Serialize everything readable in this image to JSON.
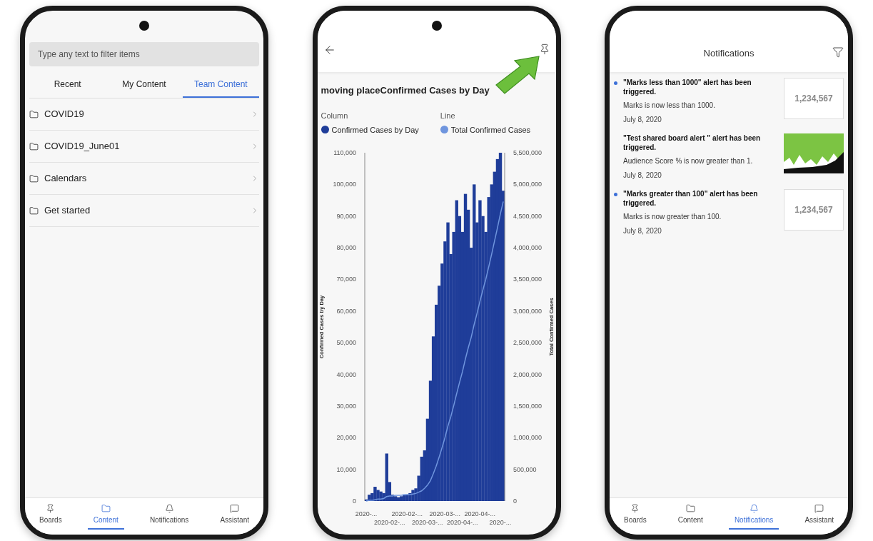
{
  "phones": [
    {
      "kind": "content",
      "search": {
        "placeholder": "Type any text to filter items"
      },
      "tabs": [
        {
          "label": "Recent",
          "selected": false
        },
        {
          "label": "My Content",
          "selected": false
        },
        {
          "label": "Team Content",
          "selected": true
        }
      ],
      "folders": [
        {
          "label": "COVID19"
        },
        {
          "label": "COVID19_June01"
        },
        {
          "label": "Calendars"
        },
        {
          "label": "Get started"
        }
      ],
      "nav": [
        {
          "kind": "boards",
          "label": "Boards",
          "selected": false
        },
        {
          "kind": "content",
          "label": "Content",
          "selected": true
        },
        {
          "kind": "notifications",
          "label": "Notifications",
          "selected": false
        },
        {
          "kind": "assistant",
          "label": "Assistant",
          "selected": false
        }
      ]
    },
    {
      "kind": "chart",
      "title": "moving placeConfirmed Cases by Day",
      "column_chart": {
        "legend_heading": "Column",
        "chart_data": {
          "type": "bar",
          "ylabel": "Confirmed Cases by Day",
          "series": [
            {
              "name": "Confirmed Cases by Day",
              "color": "#1f3d99",
              "values": [
                500,
                2000,
                2500,
                4500,
                3500,
                3000,
                2500,
                15000,
                6000,
                2000,
                1500,
                1200,
                1500,
                1800,
                2000,
                2500,
                3500,
                4000,
                8000,
                14000,
                16000,
                26000,
                38000,
                52000,
                62000,
                68000,
                75000,
                82000,
                88000,
                78000,
                85000,
                95000,
                90000,
                85000,
                97000,
                92000,
                80000,
                100000,
                88000,
                95000,
                90000,
                85000,
                96000,
                100000,
                104000,
                108000,
                110000,
                98000
              ]
            }
          ],
          "ylim": [
            0,
            110000
          ],
          "yticks": [
            {
              "value": 0,
              "label": "0"
            },
            {
              "value": 10000,
              "label": "10,000"
            },
            {
              "value": 20000,
              "label": "20,000"
            },
            {
              "value": 30000,
              "label": "30,000"
            },
            {
              "value": 40000,
              "label": "40,000"
            },
            {
              "value": 50000,
              "label": "50,000"
            },
            {
              "value": 60000,
              "label": "60,000"
            },
            {
              "value": 70000,
              "label": "70,000"
            },
            {
              "value": 80000,
              "label": "80,000"
            },
            {
              "value": 90000,
              "label": "90,000"
            },
            {
              "value": 100000,
              "label": "100,000"
            },
            {
              "value": 110000,
              "label": "110,000"
            }
          ],
          "categories": [
            "2020-...",
            null,
            null,
            null,
            null,
            null,
            null,
            null,
            "2020-02-...",
            null,
            null,
            null,
            null,
            null,
            "2020-02-...",
            null,
            null,
            null,
            null,
            null,
            null,
            "2020-03-...",
            null,
            null,
            null,
            null,
            null,
            "2020-03-...",
            null,
            null,
            null,
            null,
            null,
            "2020-04-...",
            null,
            null,
            null,
            null,
            null,
            "2020-04-...",
            null,
            null,
            null,
            null,
            null,
            null,
            "2020-...",
            null
          ]
        }
      },
      "line_chart": {
        "legend_heading": "Line",
        "chart_data": {
          "type": "line",
          "ylabel": "Total Confirmed Cases",
          "series": [
            {
              "name": "Total Confirmed Cases",
              "color": "#6f95de",
              "values": [
                0,
                10000,
                10000,
                20000,
                30000,
                30000,
                40000,
                70000,
                80000,
                80000,
                90000,
                90000,
                90000,
                100000,
                100000,
                100000,
                110000,
                120000,
                140000,
                160000,
                200000,
                250000,
                320000,
                430000,
                550000,
                690000,
                840000,
                1000000,
                1180000,
                1330000,
                1500000,
                1690000,
                1870000,
                2040000,
                2240000,
                2420000,
                2580000,
                2780000,
                2960000,
                3150000,
                3330000,
                3500000,
                3690000,
                3890000,
                4100000,
                4310000,
                4530000,
                4730000
              ]
            }
          ],
          "ylim": [
            0,
            5500000
          ],
          "yticks": [
            {
              "value": 0,
              "label": "0"
            },
            {
              "value": 500000,
              "label": "500,000"
            },
            {
              "value": 1000000,
              "label": "1,000,000"
            },
            {
              "value": 1500000,
              "label": "1,500,000"
            },
            {
              "value": 2000000,
              "label": "2,000,000"
            },
            {
              "value": 2500000,
              "label": "2,500,000"
            },
            {
              "value": 3000000,
              "label": "3,000,000"
            },
            {
              "value": 3500000,
              "label": "3,500,000"
            },
            {
              "value": 4000000,
              "label": "4,000,000"
            },
            {
              "value": 4500000,
              "label": "4,500,000"
            },
            {
              "value": 5000000,
              "label": "5,000,000"
            },
            {
              "value": 5500000,
              "label": "5,500,000"
            }
          ]
        }
      }
    },
    {
      "kind": "notifications",
      "title": "Notifications",
      "items": [
        {
          "unread": true,
          "title": "\"Marks less than 1000\" alert has been triggered.",
          "message": "Marks is now less than 1000.",
          "date": "July 8, 2020",
          "thumb": {
            "kind": "kpi",
            "value": "1,234,567"
          }
        },
        {
          "unread": false,
          "title": "\"Test shared board alert \" alert has been triggered.",
          "message": "Audience Score % is now greater than 1.",
          "date": "July 8, 2020",
          "thumb": {
            "kind": "chart"
          }
        },
        {
          "unread": true,
          "title": "\"Marks greater than 100\" alert has been triggered.",
          "message": "Marks is now greater than 100.",
          "date": "July 8, 2020",
          "thumb": {
            "kind": "kpi",
            "value": "1,234,567"
          }
        }
      ],
      "nav": [
        {
          "kind": "boards",
          "label": "Boards",
          "selected": false
        },
        {
          "kind": "content",
          "label": "Content",
          "selected": false
        },
        {
          "kind": "notifications",
          "label": "Notifications",
          "selected": true
        },
        {
          "kind": "assistant",
          "label": "Assistant",
          "selected": false
        }
      ]
    }
  ]
}
